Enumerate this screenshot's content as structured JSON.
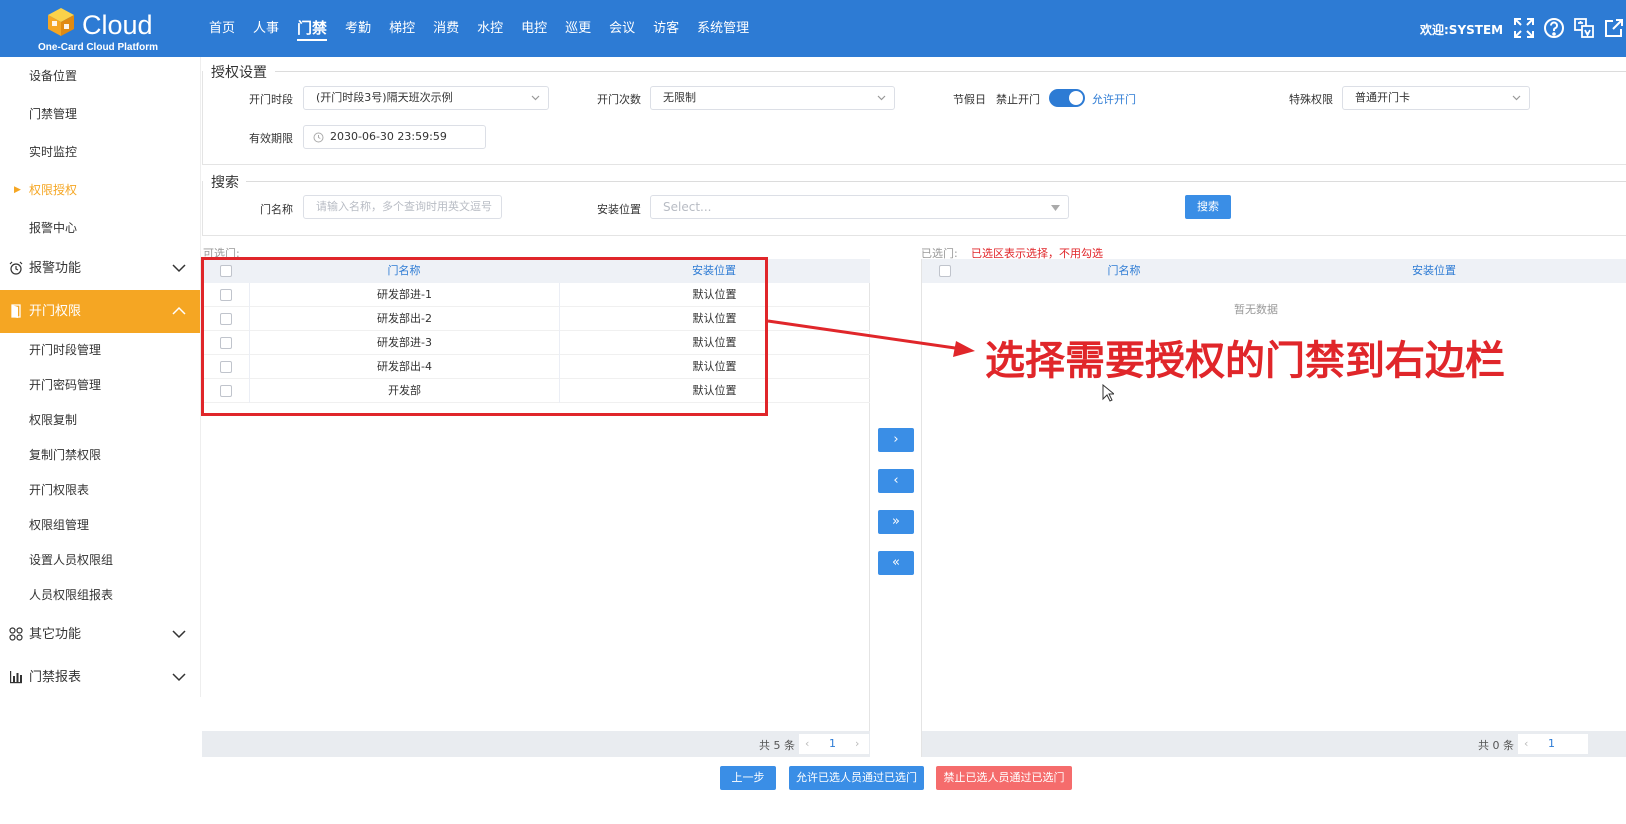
{
  "header": {
    "logo_text": "Cloud",
    "logo_sub": "One-Card Cloud Platform",
    "nav": [
      "首页",
      "人事",
      "门禁",
      "考勤",
      "梯控",
      "消费",
      "水控",
      "电控",
      "巡更",
      "会议",
      "访客",
      "系统管理"
    ],
    "active_nav": "门禁",
    "welcome": "欢迎:SYSTEM",
    "icons": [
      "fullscreen-icon",
      "help-icon",
      "language-icon",
      "external-link-icon"
    ]
  },
  "sidebar": {
    "top_items": [
      "设备位置",
      "门禁管理",
      "实时监控",
      "权限授权",
      "报警中心"
    ],
    "current_item": "权限授权",
    "group_alarm": "报警功能",
    "group_open": "开门权限",
    "open_items": [
      "开门时段管理",
      "开门密码管理",
      "权限复制",
      "复制门禁权限",
      "开门权限表",
      "权限组管理",
      "设置人员权限组",
      "人员权限组报表"
    ],
    "group_other": "其它功能",
    "group_report": "门禁报表"
  },
  "auth": {
    "title": "授权设置",
    "period_label": "开门时段",
    "period_value": "(开门时段3号)隔天班次示例",
    "count_label": "开门次数",
    "count_value": "无限制",
    "holiday_label": "节假日",
    "holiday_off": "禁止开门",
    "holiday_on": "允许开门",
    "special_label": "特殊权限",
    "special_value": "普通开门卡",
    "expire_label": "有效期限",
    "expire_value": "2030-06-30 23:59:59"
  },
  "search": {
    "title": "搜索",
    "door_label": "门名称",
    "door_placeholder": "请输入名称，多个查询时用英文逗号",
    "location_label": "安装位置",
    "location_placeholder": "Select...",
    "button": "搜索"
  },
  "left_table": {
    "caption": "可选门:",
    "columns": [
      "门名称",
      "安装位置"
    ],
    "rows": [
      {
        "name": "研发部进-1",
        "location": "默认位置"
      },
      {
        "name": "研发部出-2",
        "location": "默认位置"
      },
      {
        "name": "研发部进-3",
        "location": "默认位置"
      },
      {
        "name": "研发部出-4",
        "location": "默认位置"
      },
      {
        "name": "开发部",
        "location": "默认位置"
      }
    ],
    "total": "共 5 条",
    "page": "1"
  },
  "right_table": {
    "caption": "已选门:",
    "note": "已选区表示选择，不用勾选",
    "columns": [
      "门名称",
      "安装位置"
    ],
    "empty": "暂无数据",
    "total": "共 0 条",
    "page": "1"
  },
  "transfer": [
    "›",
    "‹",
    "»",
    "«"
  ],
  "footer": {
    "prev": "上一步",
    "allow": "允许已选人员通过已选门",
    "deny": "禁止已选人员通过已选门"
  },
  "annotation": {
    "text": "选择需要授权的门禁到右边栏"
  },
  "colors": {
    "primary": "#2d7bd4",
    "accent": "#f5a623",
    "danger": "#f56c6c",
    "annotation": "#e0262a"
  }
}
